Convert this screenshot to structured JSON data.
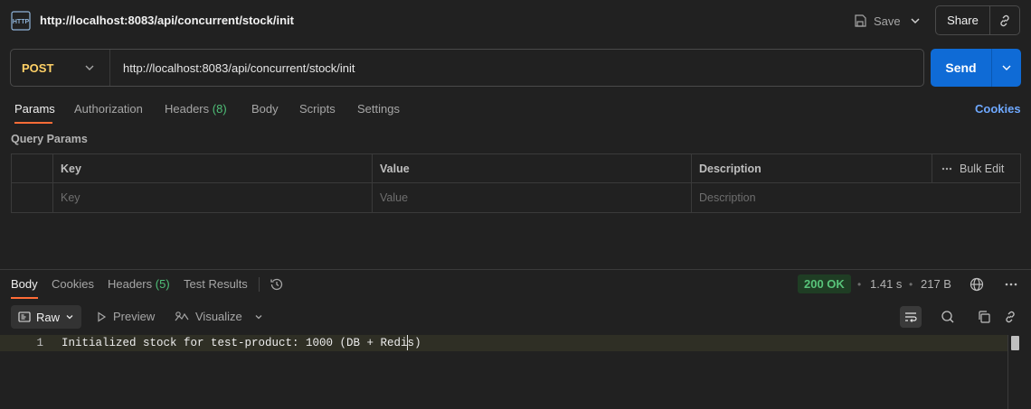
{
  "request": {
    "title": "http://localhost:8083/api/concurrent/stock/init",
    "method": "POST",
    "url": "http://localhost:8083/api/concurrent/stock/init"
  },
  "toolbar": {
    "save_label": "Save",
    "share_label": "Share",
    "send_label": "Send"
  },
  "request_tabs": {
    "params": "Params",
    "authorization": "Authorization",
    "headers": "Headers",
    "headers_count": "(8)",
    "body": "Body",
    "scripts": "Scripts",
    "settings": "Settings",
    "cookies": "Cookies"
  },
  "query_params": {
    "title": "Query Params",
    "columns": [
      "Key",
      "Value",
      "Description"
    ],
    "bulk_edit": "Bulk Edit",
    "placeholders": [
      "Key",
      "Value",
      "Description"
    ]
  },
  "response_tabs": {
    "body": "Body",
    "cookies": "Cookies",
    "headers": "Headers",
    "headers_count": "(5)",
    "test_results": "Test Results"
  },
  "response_meta": {
    "status": "200 OK",
    "time": "1.41 s",
    "size": "217 B",
    "separator": "•"
  },
  "response_toolbar": {
    "raw": "Raw",
    "preview": "Preview",
    "visualize": "Visualize"
  },
  "response_body": {
    "line_number": "1",
    "content": "Initialized stock for test-product: 1000 (DB + Redis)"
  },
  "colors": {
    "accent_orange": "#ff6c37",
    "send_blue": "#0f6bd6",
    "method_yellow": "#ffd166",
    "status_green": "#58c47a",
    "link_blue": "#6ea8fe"
  }
}
